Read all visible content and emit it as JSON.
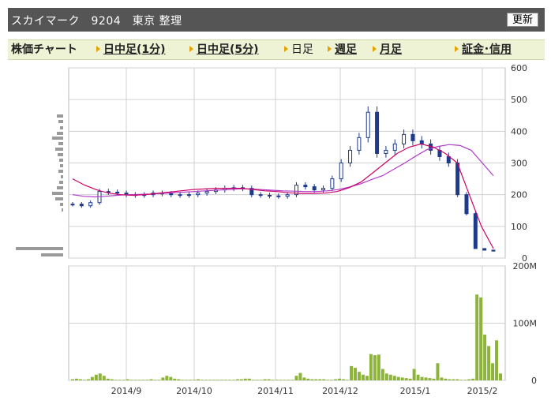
{
  "header": {
    "title": "スカイマーク　9204　東京 整理",
    "refresh_label": "更新"
  },
  "tabs": [
    {
      "label": "株価チャート",
      "link": false
    },
    {
      "label": "日中足(1分)",
      "link": true
    },
    {
      "label": "日中足(5分)",
      "link": true
    },
    {
      "label": "日足",
      "link": false,
      "selected": true
    },
    {
      "label": "週足",
      "link": true
    },
    {
      "label": "月足",
      "link": true
    },
    {
      "label": "証金･信用",
      "link": true
    }
  ],
  "colors": {
    "candle": "#1f3a8a",
    "ma_short": "#cc0066",
    "ma_long": "#b03cc8",
    "volume": "#8db43a",
    "grid": "#d0d0d0",
    "header_bg": "#555555",
    "tabs_bg": "#eef3d6"
  },
  "chart_data": [
    {
      "type": "candlestick",
      "title": "",
      "ylim": [
        0,
        600
      ],
      "y_ticks": [
        "600",
        "500",
        "400",
        "300",
        "200",
        "100",
        "0"
      ],
      "x_ticks": [
        "2014/9",
        "2014/10",
        "2014/11",
        "2014/12",
        "2015/1",
        "2015/2"
      ],
      "series_close_approx": [
        170,
        165,
        175,
        210,
        208,
        205,
        200,
        198,
        200,
        205,
        203,
        200,
        198,
        200,
        205,
        210,
        215,
        220,
        222,
        220,
        200,
        198,
        196,
        195,
        200,
        230,
        225,
        215,
        220,
        250,
        300,
        340,
        380,
        460,
        330,
        340,
        360,
        390,
        370,
        360,
        340,
        320,
        300,
        200,
        140,
        30,
        25,
        22
      ],
      "moving_averages": [
        {
          "values_approx": [
            200,
            195,
            193,
            195,
            198,
            200,
            201,
            202,
            204,
            206,
            208,
            210,
            212,
            214,
            216,
            218,
            218,
            216,
            214,
            212,
            211,
            210,
            210,
            212,
            216,
            224,
            234,
            248,
            260,
            280,
            300,
            322,
            342,
            352,
            358,
            355,
            340,
            300,
            260
          ]
        },
        {
          "values_approx": [
            250,
            230,
            215,
            205,
            200,
            198,
            200,
            204,
            208,
            212,
            216,
            218,
            220,
            220,
            220,
            216,
            212,
            210,
            206,
            204,
            204,
            205,
            210,
            222,
            240,
            270,
            300,
            330,
            350,
            360,
            350,
            330,
            300,
            200,
            100,
            30
          ]
        }
      ]
    },
    {
      "type": "bar",
      "title": "",
      "ylim": [
        0,
        200
      ],
      "y_ticks": [
        "200M",
        "100M",
        "0"
      ],
      "values_approx": [
        2,
        3,
        2,
        1,
        2,
        6,
        10,
        12,
        8,
        3,
        2,
        1,
        1,
        1,
        2,
        1,
        1,
        1,
        1,
        1,
        2,
        1,
        1,
        5,
        8,
        6,
        3,
        2,
        1,
        1,
        1,
        1,
        2,
        1,
        1,
        1,
        1,
        1,
        1,
        1,
        1,
        1,
        2,
        2,
        3,
        3,
        1,
        1,
        1,
        2,
        2,
        1,
        1,
        1,
        1,
        1,
        1,
        8,
        13,
        5,
        3,
        2,
        2,
        2,
        2,
        1,
        1,
        2,
        3,
        2,
        1,
        25,
        22,
        15,
        10,
        8,
        46,
        44,
        45,
        20,
        12,
        10,
        8,
        6,
        5,
        4,
        3,
        20,
        10,
        6,
        5,
        4,
        3,
        30,
        5,
        3,
        2,
        2,
        2,
        1,
        1,
        2,
        3,
        150,
        145,
        80,
        60,
        30,
        70,
        12
      ]
    }
  ]
}
